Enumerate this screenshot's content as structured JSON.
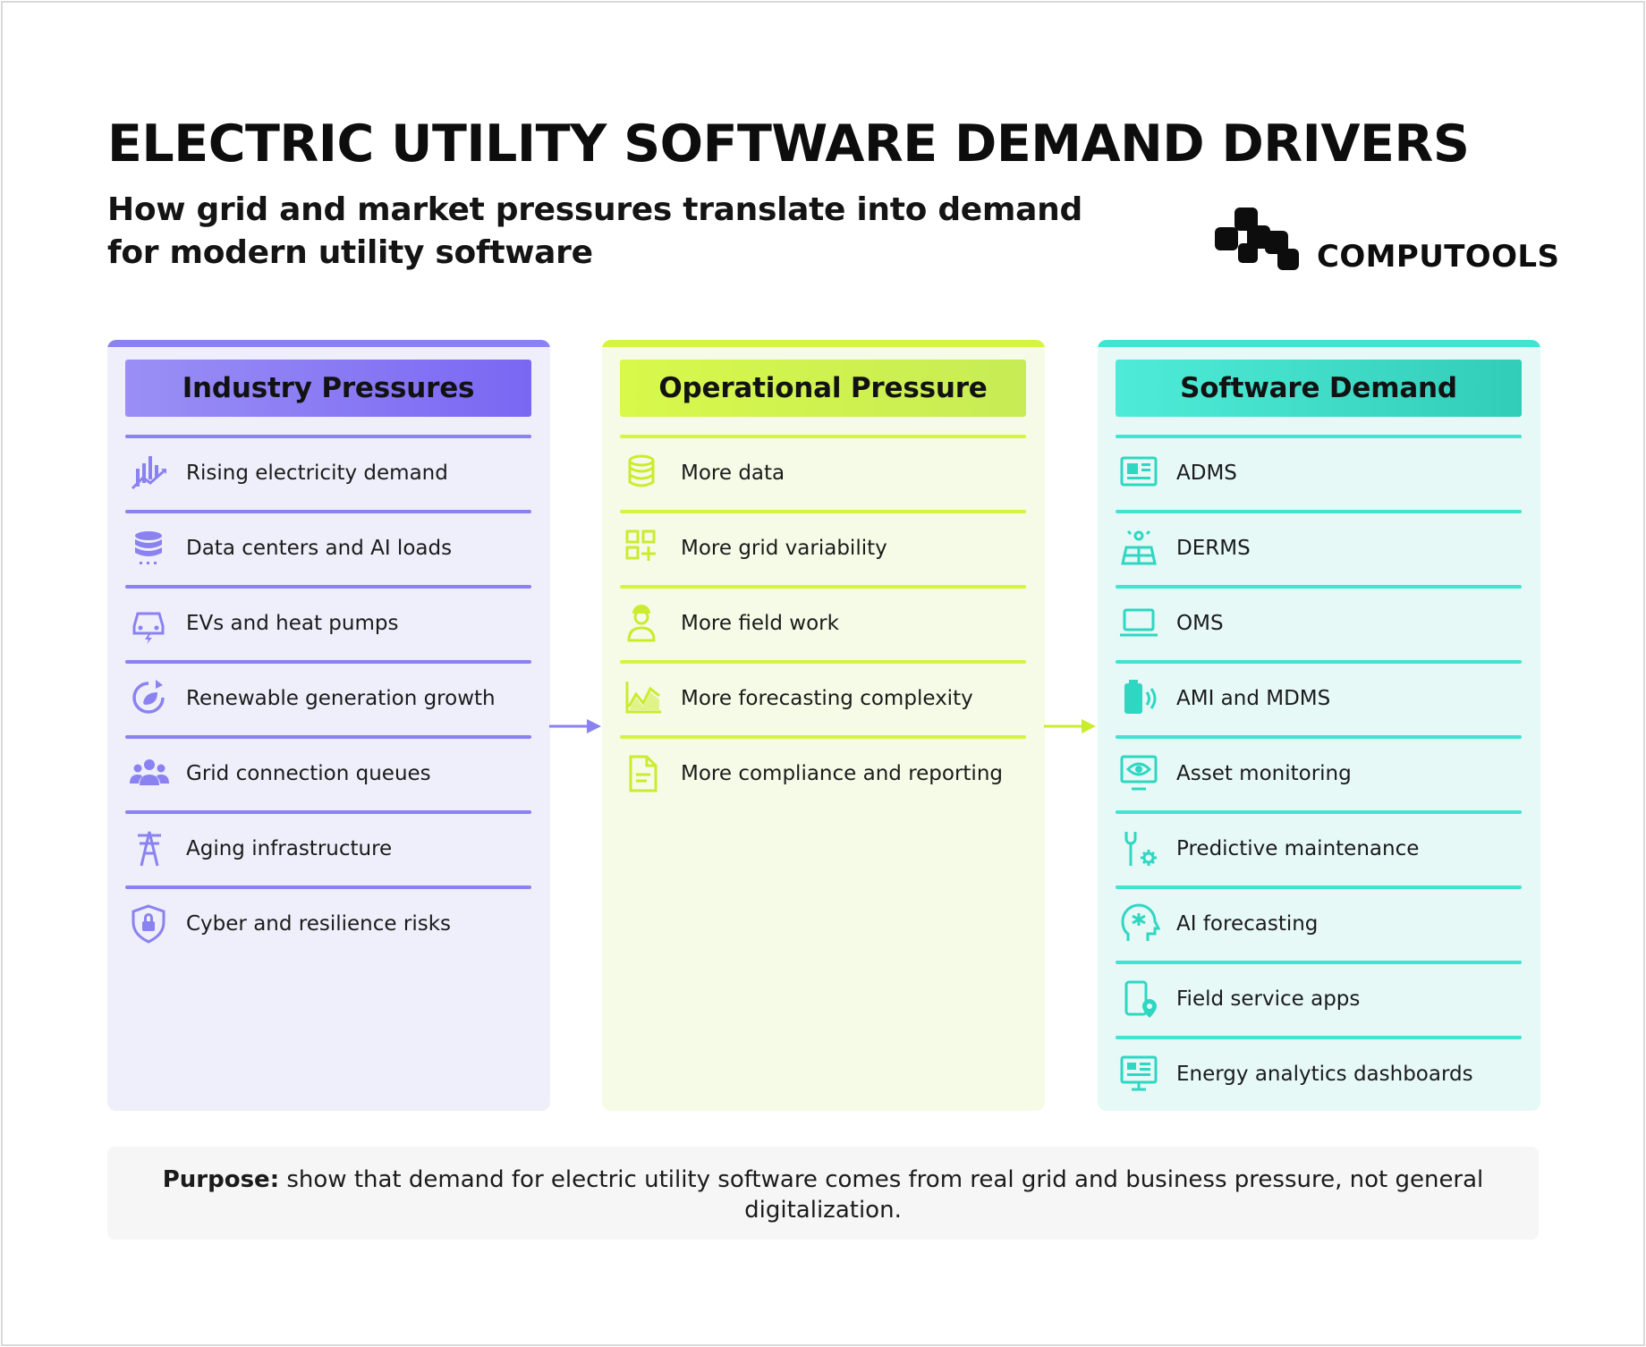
{
  "title": "ELECTRIC UTILITY SOFTWARE DEMAND DRIVERS",
  "subtitle": "How grid and market pressures translate into demand for modern utility software",
  "brand": {
    "name": "COMPUTOOLS"
  },
  "colors": {
    "industry": "#8a82f0",
    "operational": "#d4f53f",
    "software": "#41e3d1"
  },
  "columns": [
    {
      "heading": "Industry Pressures",
      "items": [
        {
          "icon": "rising-chart-icon",
          "label": "Rising electricity demand"
        },
        {
          "icon": "database-icon",
          "label": "Data centers and AI loads"
        },
        {
          "icon": "ev-car-icon",
          "label": "EVs and heat pumps"
        },
        {
          "icon": "renewable-cycle-icon",
          "label": "Renewable generation growth"
        },
        {
          "icon": "people-group-icon",
          "label": "Grid connection queues"
        },
        {
          "icon": "power-tower-icon",
          "label": "Aging infrastructure"
        },
        {
          "icon": "shield-lock-icon",
          "label": "Cyber and resilience risks"
        }
      ]
    },
    {
      "heading": "Operational Pressure",
      "items": [
        {
          "icon": "database-icon",
          "label": "More data"
        },
        {
          "icon": "grid-plus-icon",
          "label": "More grid variability"
        },
        {
          "icon": "field-worker-icon",
          "label": "More field work"
        },
        {
          "icon": "forecast-chart-icon",
          "label": "More forecasting complexity"
        },
        {
          "icon": "document-icon",
          "label": "More compliance and reporting"
        }
      ]
    },
    {
      "heading": "Software Demand",
      "items": [
        {
          "icon": "dashboard-window-icon",
          "label": "ADMS"
        },
        {
          "icon": "solar-panel-icon",
          "label": "DERMS"
        },
        {
          "icon": "laptop-icon",
          "label": "OMS"
        },
        {
          "icon": "battery-signal-icon",
          "label": "AMI and MDMS"
        },
        {
          "icon": "monitor-eye-icon",
          "label": "Asset monitoring"
        },
        {
          "icon": "wrench-gear-icon",
          "label": "Predictive maintenance"
        },
        {
          "icon": "ai-head-icon",
          "label": "AI forecasting"
        },
        {
          "icon": "mobile-location-icon",
          "label": "Field service apps"
        },
        {
          "icon": "analytics-monitor-icon",
          "label": "Energy analytics dashboards"
        }
      ]
    }
  ],
  "purpose": {
    "label": "Purpose:",
    "text": "show that demand for electric utility software comes from real grid and business pressure, not general digitalization."
  }
}
